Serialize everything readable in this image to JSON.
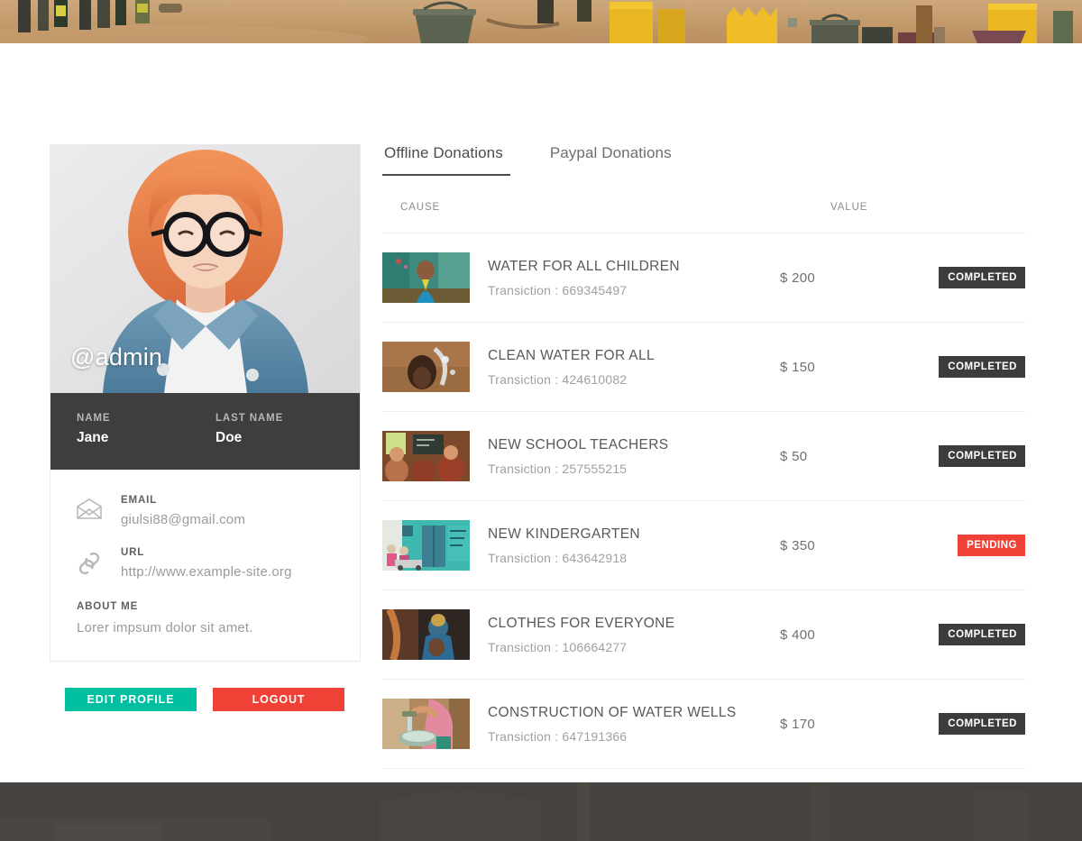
{
  "banner": {
    "alt": "yellow jerrycans and buckets lined up on sandy ground"
  },
  "footer": {
    "alt": "dark overlay photo strip"
  },
  "profile": {
    "handle": "@admin",
    "photo_alt": "portrait of woman with orange hair wearing glasses and a denim jacket",
    "name_label": "NAME",
    "name_value": "Jane",
    "lastname_label": "LAST NAME",
    "lastname_value": "Doe",
    "email_label": "EMAIL",
    "email_value": "giulsi88@gmail.com",
    "email_icon": "envelope-icon",
    "url_label": "URL",
    "url_value": "http://www.example-site.org",
    "url_icon": "link-icon",
    "about_label": "ABOUT ME",
    "about_value": "Lorer impsum dolor sit amet.",
    "edit_button": "EDIT PROFILE",
    "logout_button": "LOGOUT",
    "edit_color": "#00bfa0",
    "logout_color": "#ef4136"
  },
  "donations": {
    "tabs": [
      {
        "label": "Offline Donations",
        "active": true
      },
      {
        "label": "Paypal Donations",
        "active": false
      }
    ],
    "columns": {
      "cause": "CAUSE",
      "value": "VALUE",
      "status": ""
    },
    "status_colors": {
      "completed": "#3c3c3c",
      "pending": "#ef4136"
    },
    "rows": [
      {
        "thumb_alt": "smiling girl in blue dress drinking water by a green wall",
        "cause": "WATER FOR ALL CHILDREN",
        "transaction": "Transiction : 669345497",
        "value": "$ 200",
        "status": "COMPLETED",
        "status_kind": "completed"
      },
      {
        "thumb_alt": "child splashed with water against a brown wall",
        "cause": "CLEAN WATER FOR ALL",
        "transaction": "Transiction : 424610082",
        "value": "$ 150",
        "status": "COMPLETED",
        "status_kind": "completed"
      },
      {
        "thumb_alt": "young monks in red robes studying at a blackboard",
        "cause": "NEW SCHOOL TEACHERS",
        "transaction": "Transiction : 257555215",
        "value": "$ 50",
        "status": "COMPLETED",
        "status_kind": "completed"
      },
      {
        "thumb_alt": "children seated beside a blue door on a turquoise painted wall",
        "cause": "NEW KINDERGARTEN",
        "transaction": "Transiction : 643642918",
        "value": "$ 350",
        "status": "PENDING",
        "status_kind": "pending"
      },
      {
        "thumb_alt": "woman in blue clothing washing a child indoors",
        "cause": "CLOTHES FOR EVERYONE",
        "transaction": "Transiction : 106664277",
        "value": "$ 400",
        "status": "COMPLETED",
        "status_kind": "completed"
      },
      {
        "thumb_alt": "person in pink filling a metal basin from a tap",
        "cause": "CONSTRUCTION OF WATER WELLS",
        "transaction": "Transiction : 647191366",
        "value": "$ 170",
        "status": "COMPLETED",
        "status_kind": "completed"
      }
    ]
  }
}
